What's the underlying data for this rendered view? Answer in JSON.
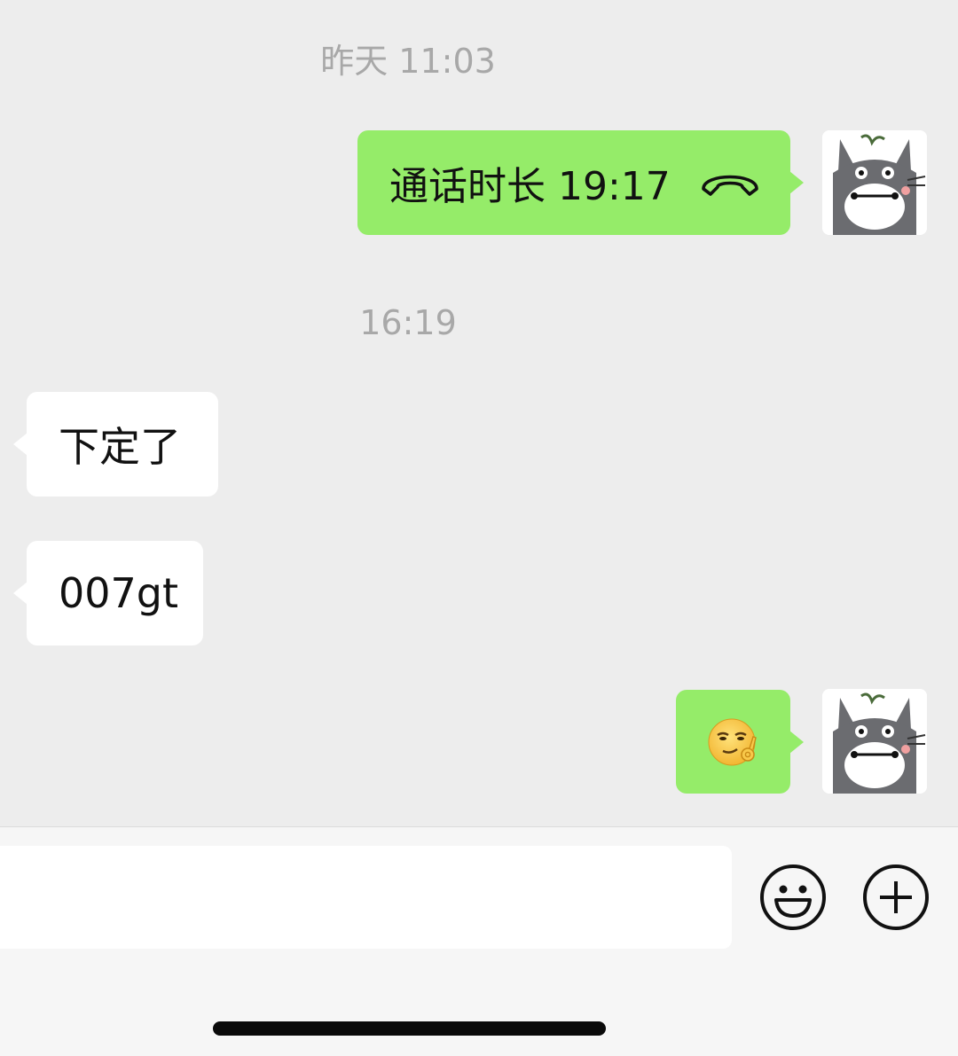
{
  "chat": {
    "timestamps": [
      "昨天 11:03",
      "16:19"
    ],
    "call_message": {
      "text": "通话时长 19:17",
      "icon": "phone-hangup-icon"
    },
    "incoming_messages": [
      "下定了",
      "007gt"
    ],
    "emoji_message": {
      "icon": "smirk-ok-emoji-icon"
    },
    "avatar": {
      "icon": "totoro-avatar-icon"
    }
  },
  "input_bar": {
    "emoji_button_icon": "smiley-face-icon",
    "plus_button_icon": "plus-circle-icon"
  },
  "colors": {
    "chat_background": "#ededed",
    "outgoing_bubble": "#95ec69",
    "incoming_bubble": "#ffffff",
    "timestamp_text": "#a8a8a8"
  }
}
